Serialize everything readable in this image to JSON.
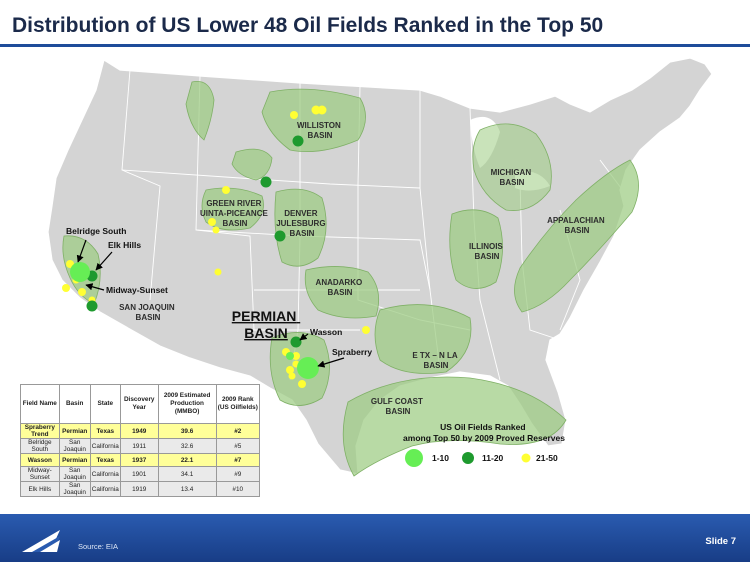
{
  "title": "Distribution of US Lower 48 Oil Fields Ranked in the Top 50",
  "map": {
    "basins": {
      "williston": [
        "WILLISTON",
        "BASIN"
      ],
      "green_river": [
        "GREEN RIVER",
        "UINTA-PICEANCE",
        "BASIN"
      ],
      "denver": [
        "DENVER",
        "JULESBURG",
        "BASIN"
      ],
      "michigan": [
        "MICHIGAN",
        "BASIN"
      ],
      "illinois": [
        "ILLINOIS",
        "BASIN"
      ],
      "appalachian": [
        "APPALACHIAN",
        "BASIN"
      ],
      "anadarko": [
        "ANADARKO",
        "BASIN"
      ],
      "san_joaquin": [
        "SAN JOAQUIN",
        "BASIN"
      ],
      "permian": [
        "PERMIAN",
        "BASIN"
      ],
      "etx": [
        "E TX – N LA",
        "BASIN"
      ],
      "gulf": [
        "GULF COAST",
        "BASIN"
      ]
    },
    "field_labels": {
      "belridge": "Belridge South",
      "elk_hills": "Elk Hills",
      "midway": "Midway-Sunset",
      "wasson": "Wasson",
      "spraberry": "Spraberry"
    },
    "colors": {
      "land": "#d4d4d4",
      "basin": "#9ccc82",
      "rank_1_10": "#66ee55",
      "rank_11_20": "#1e9a2e",
      "rank_21_50": "#ffff33"
    }
  },
  "legend": {
    "title_line1": "US Oil Fields Ranked",
    "title_line2": "among Top 50 by 2009 Proved Reserves",
    "items": [
      "1-10",
      "11-20",
      "21-50"
    ]
  },
  "table": {
    "headers": [
      "Field Name",
      "Basin",
      "State",
      "Discovery Year",
      "2009 Estimated Production (MMBO)",
      "2009 Rank (US Oilfields)"
    ],
    "rows": [
      [
        "Spraberry Trend",
        "Permian",
        "Texas",
        "1949",
        "39.6",
        "#2"
      ],
      [
        "Belridge South",
        "San Joaquin",
        "California",
        "1911",
        "32.6",
        "#5"
      ],
      [
        "Wasson",
        "Permian",
        "Texas",
        "1937",
        "22.1",
        "#7"
      ],
      [
        "Midway-Sunset",
        "San Joaquin",
        "California",
        "1901",
        "34.1",
        "#9"
      ],
      [
        "Elk Hills",
        "San Joaquin",
        "California",
        "1919",
        "13.4",
        "#10"
      ]
    ]
  },
  "footer": {
    "source": "Source: EIA",
    "slide": "Slide 7"
  }
}
